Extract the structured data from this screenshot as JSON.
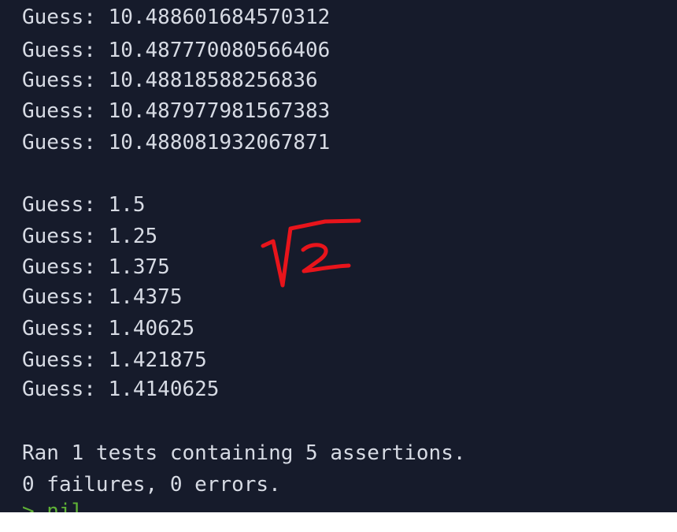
{
  "terminal": {
    "lines": [
      "Guess: 10.488601684570312",
      "Guess: 10.487770080566406",
      "Guess: 10.48818588256836",
      "Guess: 10.487977981567383",
      "Guess: 10.488081932067871",
      "",
      "Guess: 1.5",
      "Guess: 1.25",
      "Guess: 1.375",
      "Guess: 1.4375",
      "Guess: 1.40625",
      "Guess: 1.421875",
      "Guess: 1.4140625",
      "",
      "Ran 1 tests containing 5 assertions.",
      "0 failures, 0 errors."
    ],
    "prompt_line": "> nil"
  },
  "annotation": {
    "color": "#e8141b",
    "icon": "handwritten-sqrt-2-drawing"
  },
  "colors": {
    "terminal_bg": "#161b2b",
    "text": "#d7dbe4",
    "prompt": "#5fb236",
    "footer": "#ffffff"
  }
}
